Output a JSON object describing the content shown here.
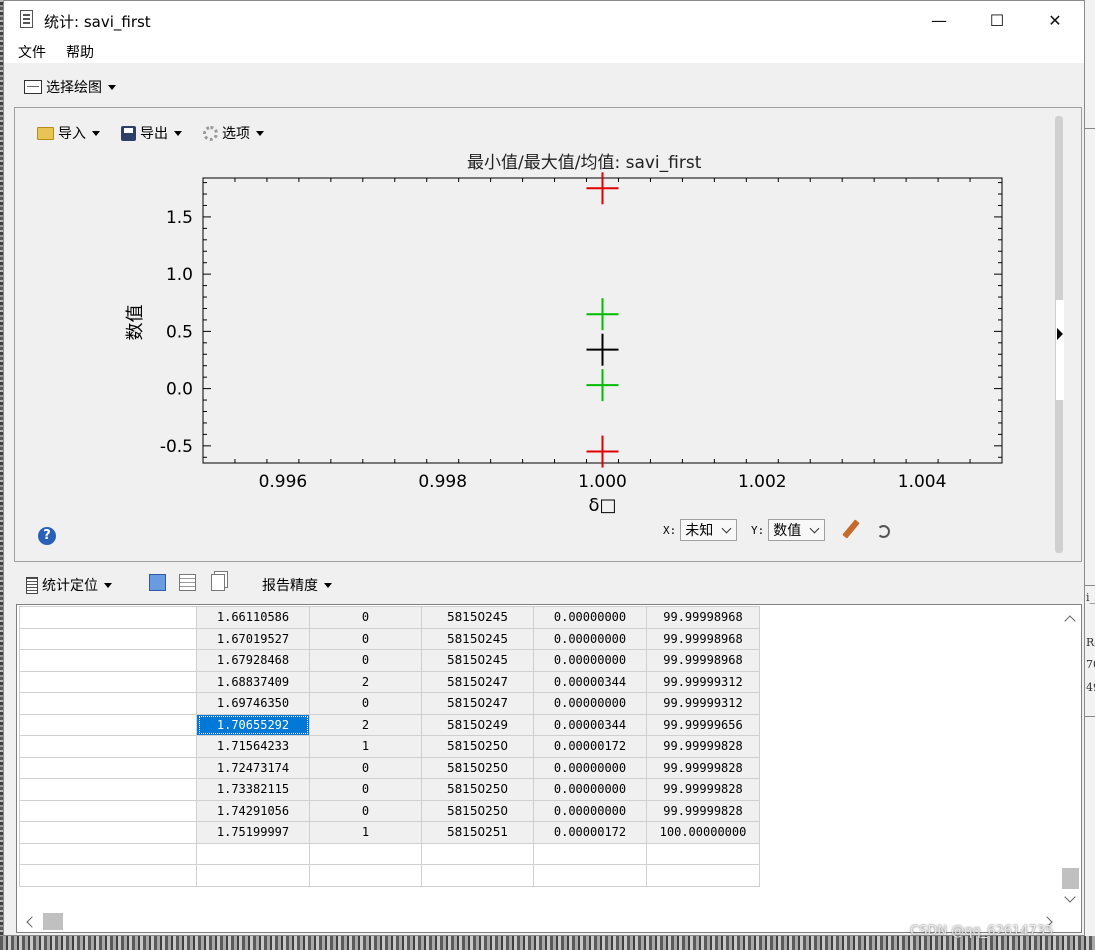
{
  "window": {
    "title": "统计: savi_first",
    "minimize": "—",
    "maximize": "☐",
    "close": "✕"
  },
  "menu": {
    "file": "文件",
    "help": "帮助"
  },
  "toolbar": {
    "select_plot": "选择绘图"
  },
  "plot_toolbar": {
    "import": "导入",
    "export": "导出",
    "options": "选项"
  },
  "chart_data": {
    "type": "scatter",
    "title": "最小值/最大值/均值: savi_first",
    "xlabel": "δ□",
    "ylabel": "数值",
    "xlim": [
      0.995,
      1.005
    ],
    "ylim": [
      -0.65,
      1.84
    ],
    "xticks": [
      0.996,
      0.998,
      1.0,
      1.002,
      1.004
    ],
    "xtick_labels": [
      "0.996",
      "0.998",
      "1.000",
      "1.002",
      "1.004"
    ],
    "yticks": [
      -0.5,
      0.0,
      0.5,
      1.0,
      1.5
    ],
    "ytick_labels": [
      "-0.5",
      "0.0",
      "0.5",
      "1.0",
      "1.5"
    ],
    "marker": "plus",
    "points": [
      {
        "x": 1.0,
        "y": 1.75,
        "color": "#e00000"
      },
      {
        "x": 1.0,
        "y": -0.55,
        "color": "#e00000"
      },
      {
        "x": 1.0,
        "y": 0.65,
        "color": "#00bb00"
      },
      {
        "x": 1.0,
        "y": 0.03,
        "color": "#00bb00"
      },
      {
        "x": 1.0,
        "y": 0.34,
        "color": "#000000"
      }
    ]
  },
  "axis_controls": {
    "x_label": "X:",
    "x_value": "未知",
    "y_label": "Y:",
    "y_value": "数值"
  },
  "help_glyph": "?",
  "lower_toolbar": {
    "stats_locate": "统计定位",
    "report_precision": "报告精度"
  },
  "table": {
    "rows": [
      [
        "",
        "1.66110586",
        "0",
        "58150245",
        "0.00000000",
        "99.99998968"
      ],
      [
        "",
        "1.67019527",
        "0",
        "58150245",
        "0.00000000",
        "99.99998968"
      ],
      [
        "",
        "1.67928468",
        "0",
        "58150245",
        "0.00000000",
        "99.99998968"
      ],
      [
        "",
        "1.68837409",
        "2",
        "58150247",
        "0.00000344",
        "99.99999312"
      ],
      [
        "",
        "1.69746350",
        "0",
        "58150247",
        "0.00000000",
        "99.99999312"
      ],
      [
        "",
        "1.70655292",
        "2",
        "58150249",
        "0.00000344",
        "99.99999656"
      ],
      [
        "",
        "1.71564233",
        "1",
        "58150250",
        "0.00000172",
        "99.99999828"
      ],
      [
        "",
        "1.72473174",
        "0",
        "58150250",
        "0.00000000",
        "99.99999828"
      ],
      [
        "",
        "1.73382115",
        "0",
        "58150250",
        "0.00000000",
        "99.99999828"
      ],
      [
        "",
        "1.74291056",
        "0",
        "58150250",
        "0.00000000",
        "99.99999828"
      ],
      [
        "",
        "1.75199997",
        "1",
        "58150251",
        "0.00000172",
        "100.00000000"
      ],
      [
        "",
        "",
        "",
        "",
        "",
        ""
      ],
      [
        "",
        "",
        "",
        "",
        "",
        ""
      ]
    ],
    "selected_row": 5,
    "selected_col": 1,
    "highlight_row": 12,
    "highlight_col": 5,
    "selection_color": "#0078d7",
    "highlight_color": "#c6efce"
  },
  "background_fragments": [
    "i_",
    "Re",
    "70",
    "49"
  ],
  "watermark": "CSDN @qq_62614735"
}
